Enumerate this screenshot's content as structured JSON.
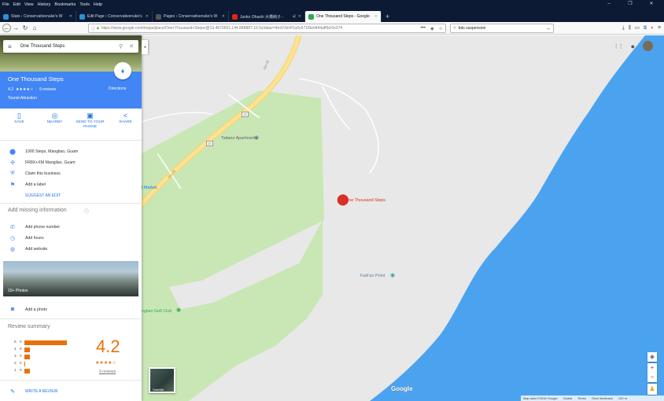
{
  "browser": {
    "menu": [
      "File",
      "Edit",
      "View",
      "History",
      "Bookmarks",
      "Tools",
      "Help"
    ],
    "tabs": [
      {
        "title": "Stats ‹ Conservativenuke's W",
        "color": "#2c8fd6"
      },
      {
        "title": "Edit Page ‹ Conservativenuke's",
        "color": "#2c8fd6"
      },
      {
        "title": "Pages ‹ Conservativenuke's W",
        "color": "#555555"
      },
      {
        "title": "Junko Ohashi 大橋純子 - ",
        "color": "#e62117"
      },
      {
        "title": "One Thousand Steps - Google",
        "color": "#34a853"
      }
    ],
    "url": "https://www.google.com/maps/place/One+Thousand+Steps/@13.4670651,144.848887,16.5z/data=!4m5!3m4!1s0x671f9e0444aff6d:0x374",
    "search_value": "bds suspension"
  },
  "maps": {
    "search_query": "One Thousand Steps",
    "place": {
      "name": "One Thousand Steps",
      "rating": "4.2",
      "stars": "★★★★☆",
      "reviews": "9 reviews",
      "type": "Tourist Attraction",
      "directions": "Directions"
    },
    "actions": [
      {
        "icon": "bookmark-icon",
        "label": "SAVE"
      },
      {
        "icon": "nearby-icon",
        "label": "NEARBY"
      },
      {
        "icon": "phone-icon",
        "label": "SEND TO YOUR PHONE"
      },
      {
        "icon": "share-icon",
        "label": "SHARE"
      }
    ],
    "info": {
      "address": "1000 Steps, Mangilao, Guam",
      "plus_code": "FR8X+XM Mangilao, Guam",
      "claim": "Claim this business",
      "label": "Add a label",
      "suggest_edit": "SUGGEST AN EDIT"
    },
    "missing": {
      "title": "Add missing information",
      "phone": "Add phone number",
      "hours": "Add hours",
      "website": "Add website"
    },
    "photos": {
      "caption": "10+ Photos",
      "add": "Add a photo"
    },
    "review_summary": {
      "title": "Review summary",
      "score": "4.2",
      "stars": "★★★★☆",
      "count": "9 reviews",
      "distribution": [
        {
          "star": "5",
          "fraction": 0.83
        },
        {
          "star": "4",
          "fraction": 0.1
        },
        {
          "star": "3",
          "fraction": 0.1
        },
        {
          "star": "2",
          "fraction": 0.0
        },
        {
          "star": "1",
          "fraction": 0.1
        }
      ],
      "write": "WRITE A REVIEW"
    },
    "map_labels": {
      "pin": "One Thousand Steps",
      "apartment": "Taitano Apartment",
      "point": "Fadi'an Point",
      "market": "t Market",
      "golf": "ngilao Golf Club",
      "road": "GU-15",
      "route_badge": "15",
      "satellite": "Satellite",
      "logo": "Google"
    },
    "footer": [
      "Map data ©2018 Google",
      "Global",
      "Terms",
      "Send feedback",
      "100 m"
    ]
  },
  "colors": {
    "accent": "#4285f4",
    "link": "#1a73e8",
    "bar": "#e8710a",
    "water": "#4ba3f0",
    "park": "#c9e7b4"
  }
}
